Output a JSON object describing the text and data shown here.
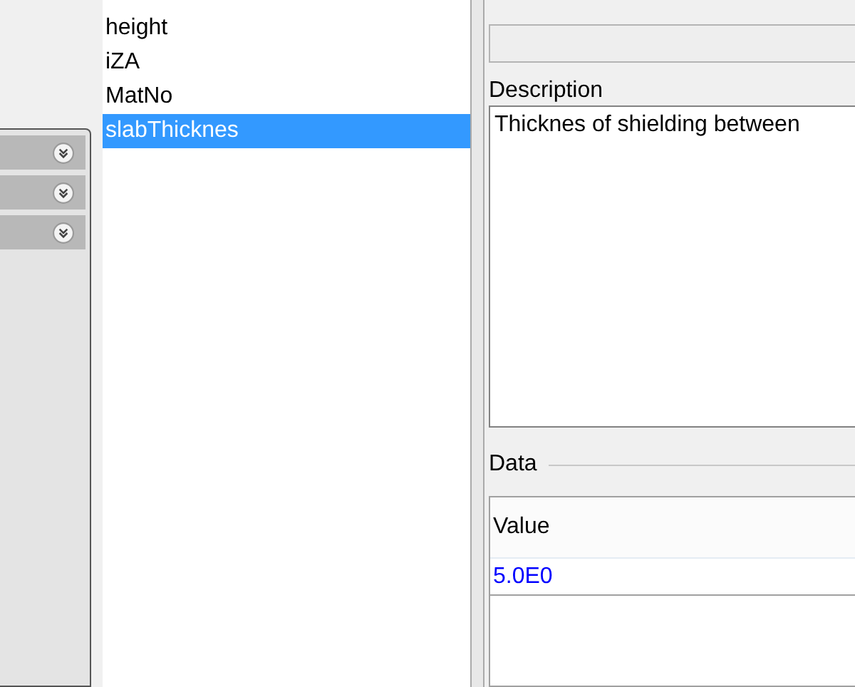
{
  "accordion": [
    {
      "expanded": false
    },
    {
      "expanded": false
    },
    {
      "expanded": false
    }
  ],
  "variables": [
    {
      "label": "height",
      "selected": false
    },
    {
      "label": "iZA",
      "selected": false
    },
    {
      "label": "MatNo",
      "selected": false
    },
    {
      "label": "slabThicknes",
      "selected": true
    }
  ],
  "description": {
    "label": "Description",
    "value": "Thicknes of shielding between"
  },
  "data": {
    "label": "Data",
    "columns": [
      "Value"
    ],
    "rows": [
      [
        "5.0E0"
      ]
    ]
  }
}
